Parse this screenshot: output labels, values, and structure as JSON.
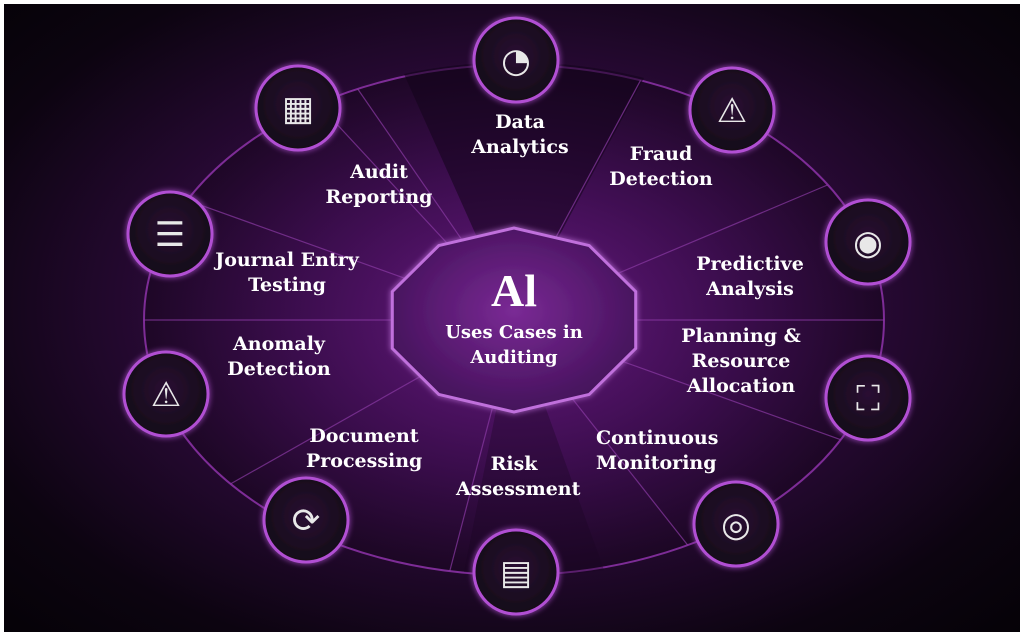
{
  "center": {
    "title": "Al",
    "subtitle_line1": "Uses Cases in",
    "subtitle_line2": "Auditing"
  },
  "segments": [
    {
      "line1": "Data",
      "line2": "Analytics",
      "icon": "pie-bar-chart-icon"
    },
    {
      "line1": "Fraud",
      "line2": "Detection",
      "icon": "magnifier-warning-icon"
    },
    {
      "line1": "Predictive",
      "line2": "Analysis",
      "icon": "eye-growth-chart-icon"
    },
    {
      "line1": "Planning &",
      "line2": "Resource",
      "line3": "Allocation",
      "icon": "org-hierarchy-icon"
    },
    {
      "line1": "Continuous",
      "line2": "Monitoring",
      "icon": "eye-monitoring-icon"
    },
    {
      "line1": "Risk",
      "line2": "Assessment",
      "icon": "document-warning-icon"
    },
    {
      "line1": "Document",
      "line2": "Processing",
      "icon": "document-cycle-icon"
    },
    {
      "line1": "Anomaly",
      "line2": "Detection",
      "icon": "warning-magnifier-icon"
    },
    {
      "line1": "Journal Entry",
      "line2": "Testing",
      "icon": "checklist-icon"
    },
    {
      "line1": "Audit",
      "line2": "Reporting",
      "icon": "report-check-icon"
    }
  ],
  "colors": {
    "background": "#0c0410",
    "accent": "#a33cc4",
    "center_fill": "#4a1463",
    "icon_fill": "#1c0a24",
    "text": "#ffffff"
  }
}
